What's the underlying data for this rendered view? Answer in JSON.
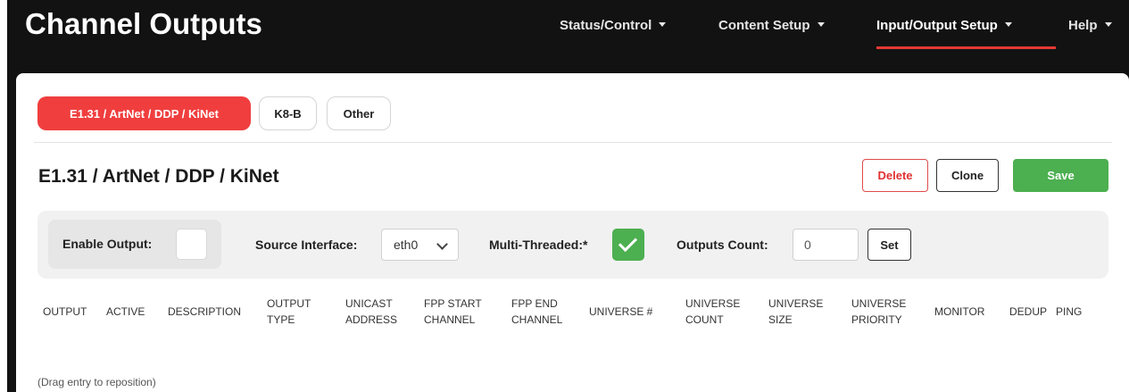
{
  "page": {
    "title": "Channel Outputs"
  },
  "nav": {
    "items": [
      {
        "label": "Status/Control"
      },
      {
        "label": "Content Setup"
      },
      {
        "label": "Input/Output Setup",
        "active": true
      },
      {
        "label": "Help"
      }
    ]
  },
  "tabs": [
    {
      "label": "E1.31 / ArtNet / DDP / KiNet",
      "active": true
    },
    {
      "label": "K8-B"
    },
    {
      "label": "Other"
    }
  ],
  "section": {
    "title": "E1.31 / ArtNet / DDP / KiNet",
    "delete_label": "Delete",
    "clone_label": "Clone",
    "save_label": "Save"
  },
  "settings": {
    "enable_output_label": "Enable Output:",
    "enable_output_checked": false,
    "source_interface_label": "Source Interface:",
    "source_interface_value": "eth0",
    "multi_threaded_label": "Multi-Threaded:*",
    "multi_threaded_checked": true,
    "outputs_count_label": "Outputs Count:",
    "outputs_count_value": "0",
    "set_label": "Set"
  },
  "table": {
    "headers": [
      [
        "OUTPUT"
      ],
      [
        "ACTIVE"
      ],
      [
        "DESCRIPTION"
      ],
      [
        "OUTPUT",
        "TYPE"
      ],
      [
        "UNICAST",
        "ADDRESS"
      ],
      [
        "FPP START",
        "CHANNEL"
      ],
      [
        "FPP END",
        "CHANNEL"
      ],
      [
        "UNIVERSE #"
      ],
      [
        "UNIVERSE",
        "COUNT"
      ],
      [
        "UNIVERSE",
        "SIZE"
      ],
      [
        "UNIVERSE",
        "PRIORITY"
      ],
      [
        "MONITOR"
      ],
      [
        "DEDUP"
      ],
      [
        "PING"
      ]
    ],
    "drag_note": "(Drag entry to reposition)"
  },
  "colors": {
    "topbar_bg": "#121212",
    "accent_red": "#f03e3e",
    "save_green": "#4caf50"
  }
}
